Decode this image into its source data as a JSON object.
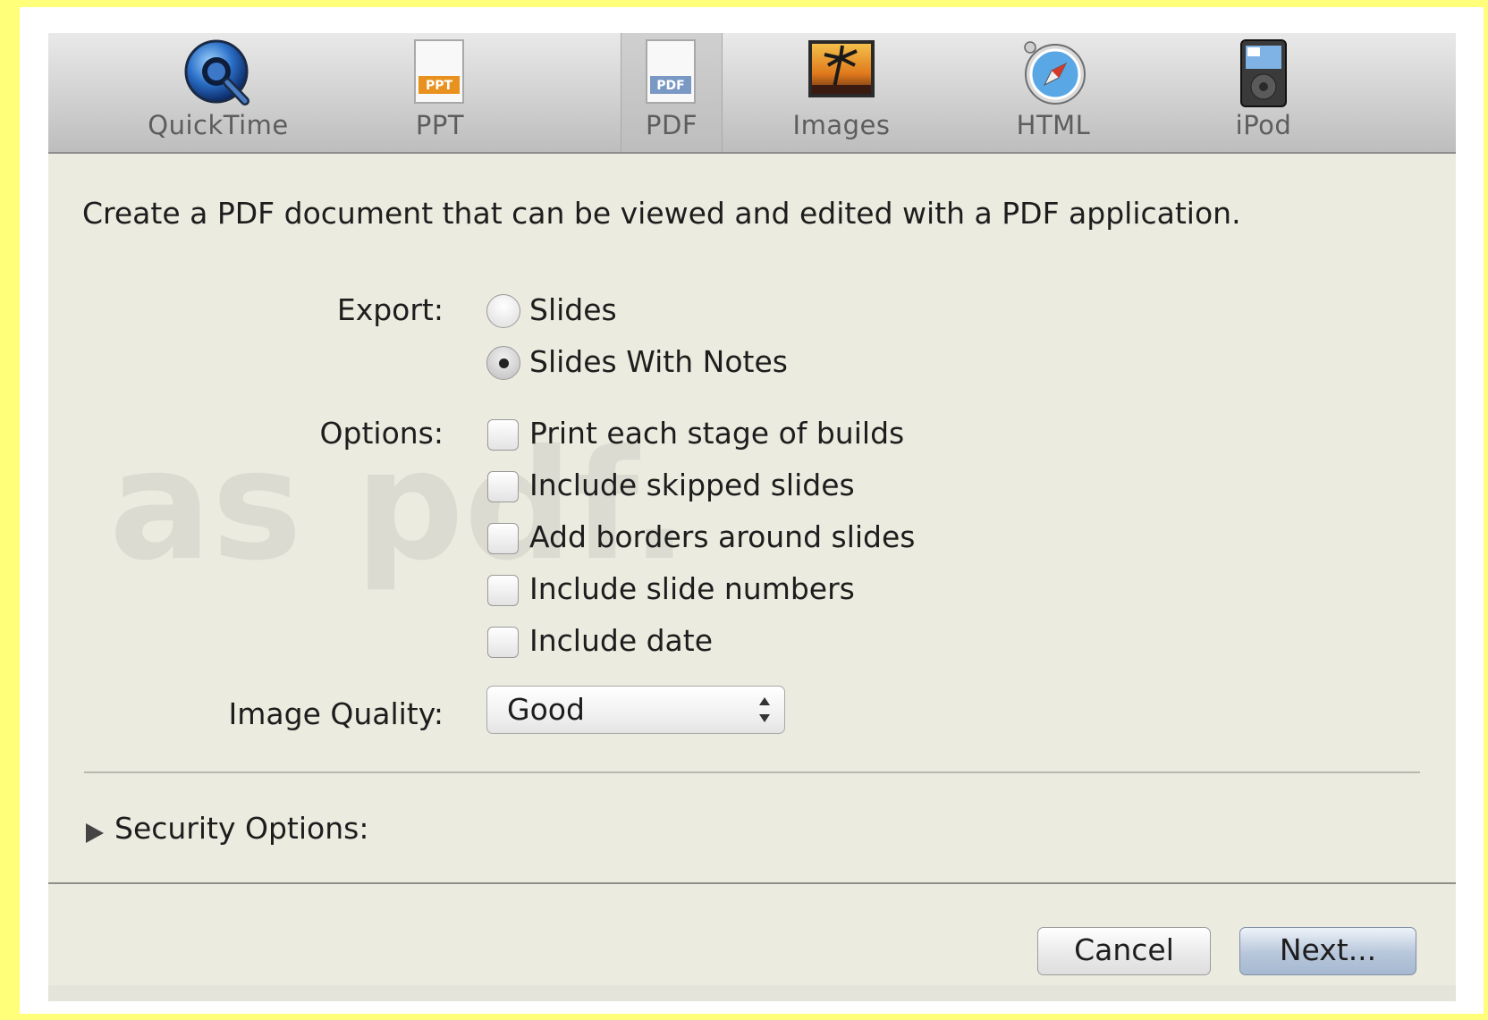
{
  "toolbar": {
    "items": [
      {
        "label": "QuickTime",
        "icon": "quicktime-icon"
      },
      {
        "label": "PPT",
        "icon": "ppt-file-icon"
      },
      {
        "label": "PDF",
        "icon": "pdf-file-icon",
        "selected": true
      },
      {
        "label": "Images",
        "icon": "images-icon"
      },
      {
        "label": "HTML",
        "icon": "safari-compass-icon"
      },
      {
        "label": "iPod",
        "icon": "ipod-icon"
      }
    ],
    "ppt_badge": "PPT",
    "pdf_badge": "PDF"
  },
  "description": "Create a PDF document that can be viewed and edited with a PDF application.",
  "watermark": "as pdf.",
  "export": {
    "label": "Export:",
    "options": [
      {
        "label": "Slides",
        "checked": false
      },
      {
        "label": "Slides With Notes",
        "checked": true
      }
    ]
  },
  "options": {
    "label": "Options:",
    "items": [
      {
        "label": "Print each stage of builds",
        "checked": false
      },
      {
        "label": "Include skipped slides",
        "checked": false
      },
      {
        "label": "Add borders around slides",
        "checked": false
      },
      {
        "label": "Include slide numbers",
        "checked": false
      },
      {
        "label": "Include date",
        "checked": false
      }
    ]
  },
  "image_quality": {
    "label": "Image Quality:",
    "value": "Good"
  },
  "security": {
    "label": "Security Options:"
  },
  "buttons": {
    "cancel": "Cancel",
    "next": "Next..."
  },
  "colors": {
    "page_background": "#ffff7a",
    "dialog_background": "#ebebdf",
    "default_button": "#b7c6da"
  }
}
